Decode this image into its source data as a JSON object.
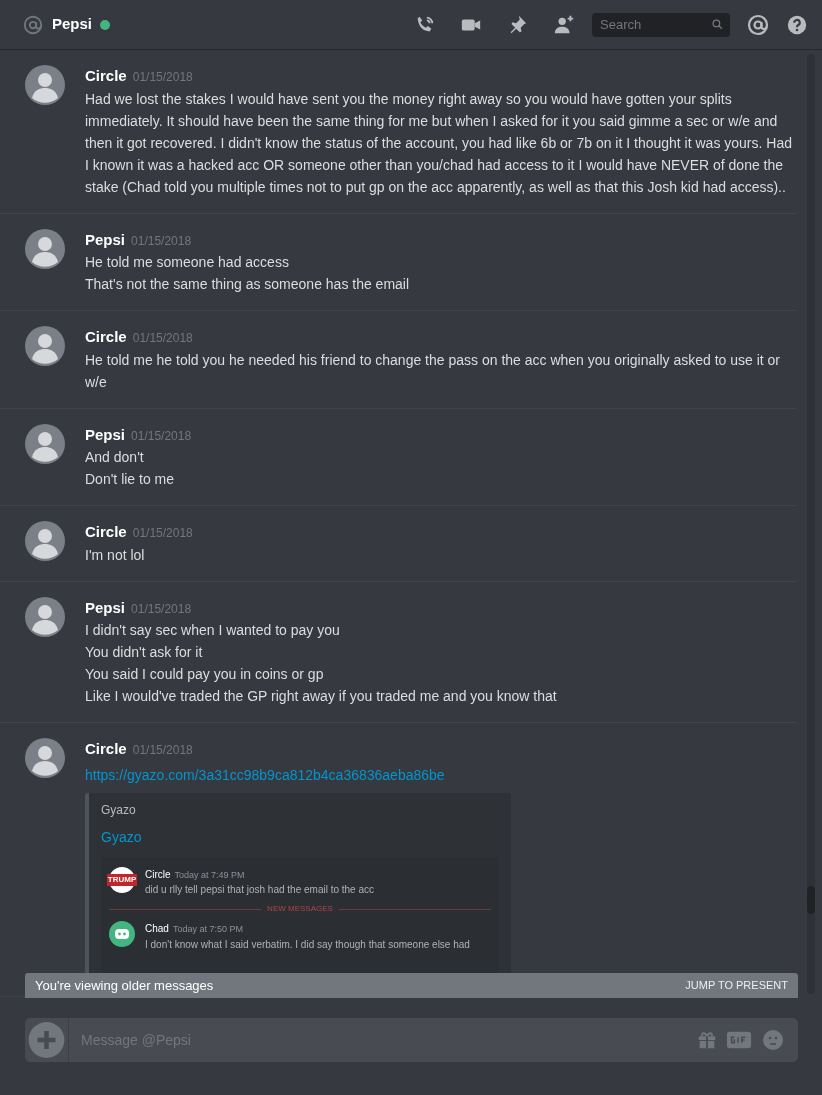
{
  "header": {
    "channel": "Pepsi",
    "online": true,
    "search_placeholder": "Search"
  },
  "messages": [
    {
      "author": "Circle",
      "timestamp": "01/15/2018",
      "lines": [
        "Had we lost the stakes I would have sent you the money right away so you would have gotten your splits immediately. It should have been the same thing for me but when I asked for it you said gimme a sec or w/e and then it got recovered. I didn't know the status of the account, you had like 6b or 7b on it I thought it was yours. Had I known it was a hacked acc OR someone other than you/chad had access to it I would have NEVER of done the stake (Chad told you multiple times not to put gp on the acc apparently, as well as that this Josh kid had access).."
      ]
    },
    {
      "author": "Pepsi",
      "timestamp": "01/15/2018",
      "lines": [
        "He told me someone had access",
        "That's not the same thing as someone has the email"
      ]
    },
    {
      "author": "Circle",
      "timestamp": "01/15/2018",
      "lines": [
        "He told me he told you he needed his friend to change the pass on the acc when you originally asked to use it or w/e"
      ]
    },
    {
      "author": "Pepsi",
      "timestamp": "01/15/2018",
      "lines": [
        "And don't",
        "Don't lie to me"
      ]
    },
    {
      "author": "Circle",
      "timestamp": "01/15/2018",
      "lines": [
        "I'm not lol"
      ]
    },
    {
      "author": "Pepsi",
      "timestamp": "01/15/2018",
      "lines": [
        "I didn't say sec when I wanted to pay you",
        "You didn't ask for it",
        "You said I could pay you in coins or gp",
        "Like I would've traded the GP right away if you traded me and you know that"
      ]
    },
    {
      "author": "Circle",
      "timestamp": "01/15/2018",
      "link": "https://gyazo.com/3a31cc98b9ca812b4ca36836aeba86be",
      "embed": {
        "provider": "Gyazo",
        "title": "Gyazo",
        "screenshot": [
          {
            "author": "Circle",
            "timestamp": "Today at 7:49 PM",
            "text": "did u rlly tell pepsi that josh had the email to the acc",
            "avatar": "TRUMP"
          },
          {
            "kind": "divider",
            "text": "NEW MESSAGES"
          },
          {
            "author": "Chad",
            "timestamp": "Today at 7:50 PM",
            "text": "I don't know what I said verbatim. I did say though that someone else had"
          }
        ]
      }
    }
  ],
  "older_bar": {
    "text": "You're viewing older messages",
    "action": "JUMP TO PRESENT"
  },
  "composer": {
    "placeholder": "Message @Pepsi"
  }
}
